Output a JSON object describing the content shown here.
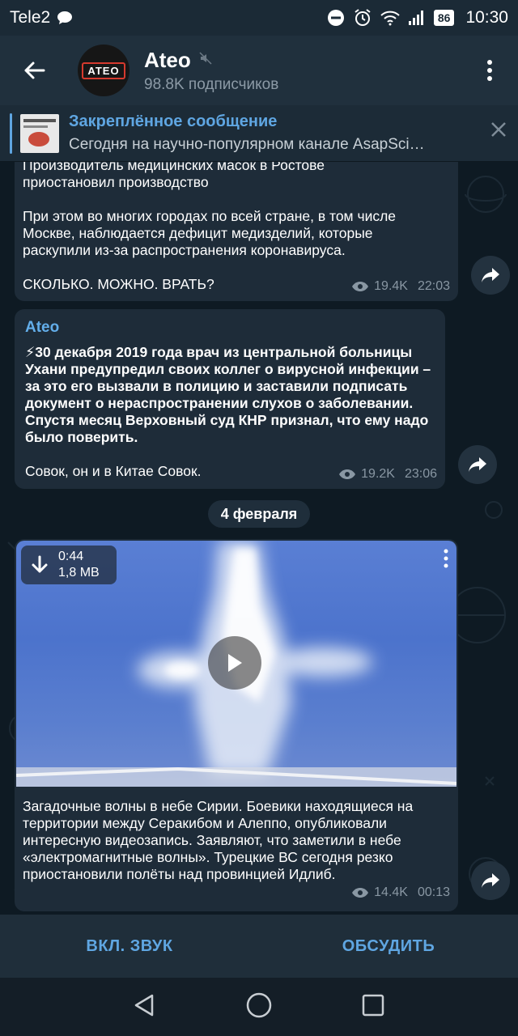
{
  "status_bar": {
    "carrier": "Tele2",
    "battery": "86",
    "time": "10:30"
  },
  "header": {
    "avatar_text": "ATEO",
    "title": "Ateo",
    "subtitle": "98.8K подписчиков"
  },
  "pinned": {
    "title": "Закреплённое сообщение",
    "text": "Сегодня на научно-популярном канале AsapSci…"
  },
  "messages": [
    {
      "lines": [
        "Производитель медицинских масок в Ростове приостановил производство",
        "При этом во многих городах по всей стране, в том числе Москве, наблюдается дефицит медизделий, которые раскупили из-за распространения коронавируса.",
        "СКОЛЬКО. МОЖНО. ВРАТЬ?"
      ],
      "views": "19.4K",
      "time": "22:03"
    },
    {
      "author": "Ateo",
      "bold_text": "⚡30 декабря 2019 года врач из центральной больницы Ухани предупредил своих коллег о вирусной инфекции – за это его вызвали в полицию и заставили подписать документ о нераспространении слухов о заболевании. Спустя месяц Верховный суд КНР признал, что ему надо было поверить.",
      "text": "Совок, он и в Китае Совок.",
      "views": "19.2K",
      "time": "23:06"
    },
    {
      "video": {
        "duration": "0:44",
        "size": "1,8 MB"
      },
      "text": "Загадочные волны в небе Сирии. Боевики находящиеся на территории между Серакибом и Алеппо, опубликовали интересную видеозапись. Заявляют, что заметили в небе «электромагнитные волны». Турецкие ВС сегодня резко приостановили полёты  над провинцией Идлиб.",
      "views": "14.4K",
      "time": "00:13"
    }
  ],
  "date_separator": "4 февраля",
  "actions": {
    "unmute": "ВКЛ. ЗВУК",
    "discuss": "ОБСУДИТЬ"
  }
}
